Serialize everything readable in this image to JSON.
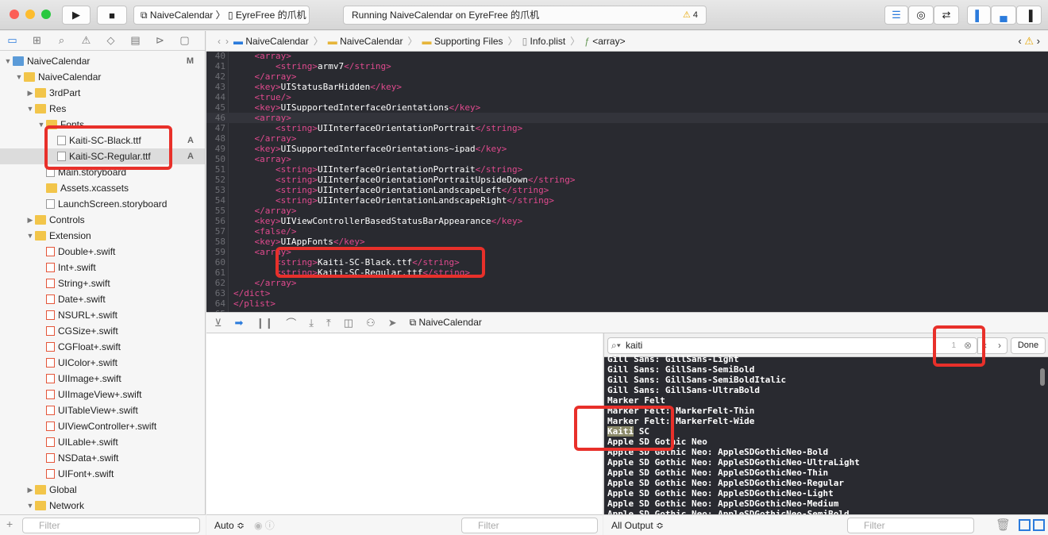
{
  "toolbar": {
    "scheme_app": "NaiveCalendar",
    "scheme_device": "EyreFree 的爪机",
    "activity": "Running NaiveCalendar on EyreFree 的爪机",
    "warning_count": "4"
  },
  "navigator": {
    "items": [
      {
        "label": "NaiveCalendar",
        "depth": 0,
        "type": "project",
        "expanded": true,
        "badge": "M"
      },
      {
        "label": "NaiveCalendar",
        "depth": 1,
        "type": "folder",
        "expanded": true
      },
      {
        "label": "3rdPart",
        "depth": 2,
        "type": "folder",
        "expanded": false
      },
      {
        "label": "Res",
        "depth": 2,
        "type": "folder",
        "expanded": true
      },
      {
        "label": "Fonts",
        "depth": 3,
        "type": "folder",
        "expanded": true
      },
      {
        "label": "Kaiti-SC-Black.ttf",
        "depth": 4,
        "type": "file",
        "badge": "A"
      },
      {
        "label": "Kaiti-SC-Regular.ttf",
        "depth": 4,
        "type": "file",
        "badge": "A",
        "selected": true
      },
      {
        "label": "Main.storyboard",
        "depth": 3,
        "type": "file"
      },
      {
        "label": "Assets.xcassets",
        "depth": 3,
        "type": "folder"
      },
      {
        "label": "LaunchScreen.storyboard",
        "depth": 3,
        "type": "file"
      },
      {
        "label": "Controls",
        "depth": 2,
        "type": "folder",
        "expanded": false
      },
      {
        "label": "Extension",
        "depth": 2,
        "type": "folder",
        "expanded": true
      },
      {
        "label": "Double+.swift",
        "depth": 3,
        "type": "swift"
      },
      {
        "label": "Int+.swift",
        "depth": 3,
        "type": "swift"
      },
      {
        "label": "String+.swift",
        "depth": 3,
        "type": "swift"
      },
      {
        "label": "Date+.swift",
        "depth": 3,
        "type": "swift"
      },
      {
        "label": "NSURL+.swift",
        "depth": 3,
        "type": "swift"
      },
      {
        "label": "CGSize+.swift",
        "depth": 3,
        "type": "swift"
      },
      {
        "label": "CGFloat+.swift",
        "depth": 3,
        "type": "swift"
      },
      {
        "label": "UIColor+.swift",
        "depth": 3,
        "type": "swift"
      },
      {
        "label": "UIImage+.swift",
        "depth": 3,
        "type": "swift"
      },
      {
        "label": "UIImageView+.swift",
        "depth": 3,
        "type": "swift"
      },
      {
        "label": "UITableView+.swift",
        "depth": 3,
        "type": "swift"
      },
      {
        "label": "UIViewController+.swift",
        "depth": 3,
        "type": "swift"
      },
      {
        "label": "UILable+.swift",
        "depth": 3,
        "type": "swift"
      },
      {
        "label": "NSData+.swift",
        "depth": 3,
        "type": "swift"
      },
      {
        "label": "UIFont+.swift",
        "depth": 3,
        "type": "swift"
      },
      {
        "label": "Global",
        "depth": 2,
        "type": "folder",
        "expanded": false
      },
      {
        "label": "Network",
        "depth": 2,
        "type": "folder",
        "expanded": true
      }
    ],
    "filter_placeholder": "Filter"
  },
  "jumpbar": [
    "NaiveCalendar",
    "NaiveCalendar",
    "Supporting Files",
    "Info.plist",
    "<array>"
  ],
  "editor": {
    "current_line": 46,
    "lines": [
      {
        "n": "40",
        "indent": 1,
        "t": "<array>"
      },
      {
        "n": "41",
        "indent": 2,
        "t": "<string>",
        "v": "armv7",
        "c": "</string>"
      },
      {
        "n": "42",
        "indent": 1,
        "t": "</array>"
      },
      {
        "n": "43",
        "indent": 1,
        "t": "<key>",
        "v": "UIStatusBarHidden",
        "c": "</key>"
      },
      {
        "n": "44",
        "indent": 1,
        "t": "<true/>"
      },
      {
        "n": "45",
        "indent": 1,
        "t": "<key>",
        "v": "UISupportedInterfaceOrientations",
        "c": "</key>"
      },
      {
        "n": "46",
        "indent": 1,
        "t": "<array>"
      },
      {
        "n": "47",
        "indent": 2,
        "t": "<string>",
        "v": "UIInterfaceOrientationPortrait",
        "c": "</string>"
      },
      {
        "n": "48",
        "indent": 1,
        "t": "</array>"
      },
      {
        "n": "49",
        "indent": 1,
        "t": "<key>",
        "v": "UISupportedInterfaceOrientations~ipad",
        "c": "</key>"
      },
      {
        "n": "50",
        "indent": 1,
        "t": "<array>"
      },
      {
        "n": "51",
        "indent": 2,
        "t": "<string>",
        "v": "UIInterfaceOrientationPortrait",
        "c": "</string>"
      },
      {
        "n": "52",
        "indent": 2,
        "t": "<string>",
        "v": "UIInterfaceOrientationPortraitUpsideDown",
        "c": "</string>"
      },
      {
        "n": "53",
        "indent": 2,
        "t": "<string>",
        "v": "UIInterfaceOrientationLandscapeLeft",
        "c": "</string>"
      },
      {
        "n": "54",
        "indent": 2,
        "t": "<string>",
        "v": "UIInterfaceOrientationLandscapeRight",
        "c": "</string>"
      },
      {
        "n": "55",
        "indent": 1,
        "t": "</array>"
      },
      {
        "n": "56",
        "indent": 1,
        "t": "<key>",
        "v": "UIViewControllerBasedStatusBarAppearance",
        "c": "</key>"
      },
      {
        "n": "57",
        "indent": 1,
        "t": "<false/>"
      },
      {
        "n": "58",
        "indent": 1,
        "t": "<key>",
        "v": "UIAppFonts",
        "c": "</key>"
      },
      {
        "n": "59",
        "indent": 1,
        "t": "<array>"
      },
      {
        "n": "60",
        "indent": 2,
        "t": "<string>",
        "v": "Kaiti-SC-Black.ttf",
        "c": "</string>"
      },
      {
        "n": "61",
        "indent": 2,
        "t": "<string>",
        "v": "Kaiti-SC-Regular.ttf",
        "c": "</string>"
      },
      {
        "n": "62",
        "indent": 1,
        "t": "</array>"
      },
      {
        "n": "63",
        "indent": 0,
        "t": "</dict>"
      },
      {
        "n": "64",
        "indent": 0,
        "t": "</plist>"
      },
      {
        "n": "65",
        "indent": 0,
        "t": ""
      }
    ]
  },
  "debugbar": {
    "process": "NaiveCalendar"
  },
  "variables": {
    "scope": "Auto ≎",
    "filter_placeholder": "Filter"
  },
  "console": {
    "search_value": "kaiti",
    "match_count": "1",
    "done_label": "Done",
    "lines": [
      "Gill Sans: GillSans-Light",
      "Gill Sans: GillSans-SemiBold",
      "Gill Sans: GillSans-SemiBoldItalic",
      "Gill Sans: GillSans-UltraBold",
      "Marker Felt",
      "Marker Felt: MarkerFelt-Thin",
      "Marker Felt: MarkerFelt-Wide",
      "Kaiti SC",
      "Apple SD Gothic Neo",
      "Apple SD Gothic Neo: AppleSDGothicNeo-Bold",
      "Apple SD Gothic Neo: AppleSDGothicNeo-UltraLight",
      "Apple SD Gothic Neo: AppleSDGothicNeo-Thin",
      "Apple SD Gothic Neo: AppleSDGothicNeo-Regular",
      "Apple SD Gothic Neo: AppleSDGothicNeo-Light",
      "Apple SD Gothic Neo: AppleSDGothicNeo-Medium",
      "Apple SD Gothic Neo: AppleSDGothicNeo-SemiBold"
    ],
    "highlight": "Kaiti",
    "output_selector": "All Output ≎",
    "filter_placeholder": "Filter"
  },
  "colors": {
    "annotation": "#e8302a",
    "tag": "#e04a8e",
    "editor_bg": "#292a30",
    "accent": "#2b7bdc"
  }
}
